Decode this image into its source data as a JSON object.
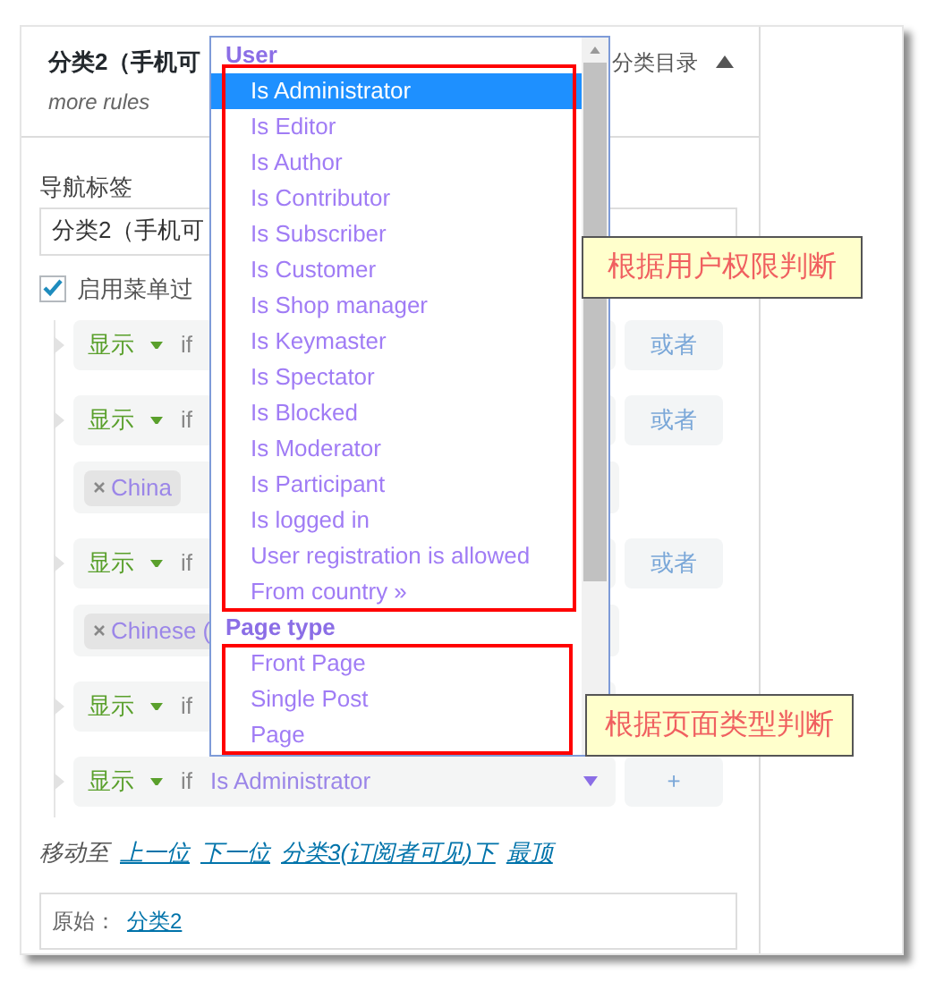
{
  "menu_item": {
    "title": "分类2（手机可",
    "type_label": "分类目录",
    "expanded": true,
    "subtitle": "more rules"
  },
  "nav_label": {
    "label": "导航标签",
    "value": "分类2（手机可"
  },
  "enable_filter": {
    "label": "启用菜单过",
    "checked": true
  },
  "rules": [
    {
      "kind": "rule",
      "action": "显示",
      "connector": "if",
      "or_button": "或者"
    },
    {
      "kind": "rule",
      "action": "显示",
      "connector": "if",
      "or_button": "或者"
    },
    {
      "kind": "tag",
      "tag": "China"
    },
    {
      "kind": "rule",
      "action": "显示",
      "connector": "if",
      "or_button": "或者"
    },
    {
      "kind": "tag",
      "tag": "Chinese ("
    },
    {
      "kind": "rule",
      "action": "显示",
      "connector": "if"
    },
    {
      "kind": "rule",
      "action": "显示",
      "connector": "if",
      "condition": "Is Administrator",
      "add_button": "+"
    }
  ],
  "move_to": {
    "label": "移动至",
    "links": [
      "上一位",
      "下一位",
      "分类3(订阅者可见)下",
      "最顶"
    ]
  },
  "original": {
    "label": "原始：",
    "link": "分类2"
  },
  "dropdown": {
    "groups": [
      {
        "label": "User",
        "options": [
          {
            "label": "Is Administrator",
            "selected": true
          },
          {
            "label": "Is Editor",
            "selected": false
          },
          {
            "label": "Is Author",
            "selected": false
          },
          {
            "label": "Is Contributor",
            "selected": false
          },
          {
            "label": "Is Subscriber",
            "selected": false
          },
          {
            "label": "Is Customer",
            "selected": false
          },
          {
            "label": "Is Shop manager",
            "selected": false
          },
          {
            "label": "Is Keymaster",
            "selected": false
          },
          {
            "label": "Is Spectator",
            "selected": false
          },
          {
            "label": "Is Blocked",
            "selected": false
          },
          {
            "label": "Is Moderator",
            "selected": false
          },
          {
            "label": "Is Participant",
            "selected": false
          },
          {
            "label": "Is logged in",
            "selected": false
          },
          {
            "label": "User registration is allowed",
            "selected": false
          },
          {
            "label": "From country »",
            "selected": false
          }
        ]
      },
      {
        "label": "Page type",
        "options": [
          {
            "label": "Front Page",
            "selected": false
          },
          {
            "label": "Single Post",
            "selected": false
          },
          {
            "label": "Page",
            "selected": false
          }
        ]
      }
    ]
  },
  "annotations": [
    {
      "text": "根据用户权限判断"
    },
    {
      "text": "根据页面类型判断"
    }
  ]
}
